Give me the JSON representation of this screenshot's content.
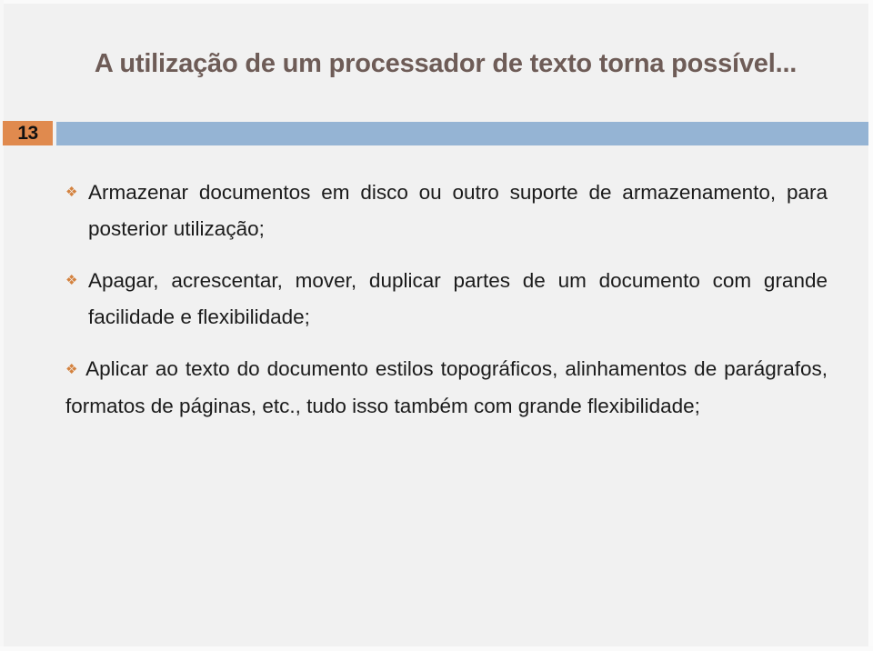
{
  "slide": {
    "title": "A utilização de um processador de texto torna possível...",
    "number": "13",
    "bullet_glyph": "❖",
    "colors": {
      "background": "#f1f1f1",
      "title_text": "#6e5c57",
      "badge_orange": "#e08a4e",
      "rule_blue": "#95b4d4",
      "bullet_orange": "#d4823f",
      "body_text": "#1b1b1b"
    },
    "bullets": [
      {
        "text": "Armazenar documentos em disco ou outro suporte de armazenamento, para posterior utilização;"
      },
      {
        "text": "Apagar, acrescentar, mover, duplicar partes de um documento com grande facilidade e flexibilidade;"
      },
      {
        "text": "Aplicar ao texto do documento estilos topográficos, alinhamentos de parágrafos, formatos de páginas, etc., tudo isso também com grande flexibilidade;"
      }
    ]
  }
}
